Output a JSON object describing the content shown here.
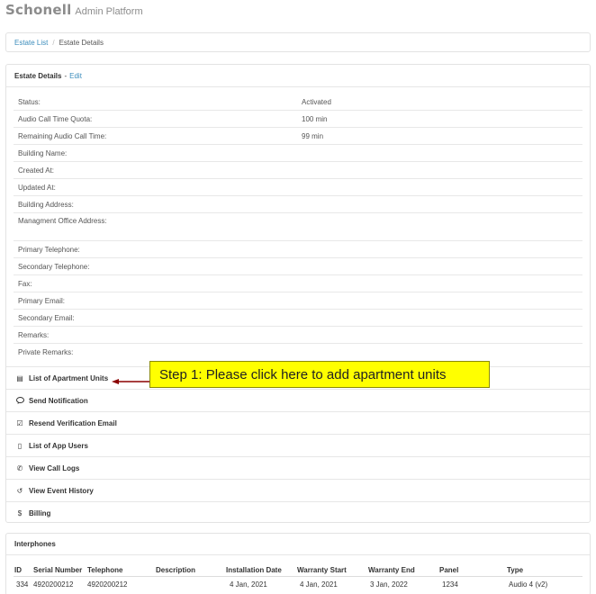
{
  "header": {
    "brand": "Schonell",
    "subtitle": "Admin Platform"
  },
  "breadcrumb": {
    "link": "Estate List",
    "separator": "/",
    "current": "Estate Details"
  },
  "estate": {
    "heading": "Estate Details",
    "dash": "-",
    "edit_label": "Edit",
    "fields": [
      {
        "label": "Status:",
        "value": "Activated"
      },
      {
        "label": "Audio Call Time Quota:",
        "value": "100 min"
      },
      {
        "label": "Remaining Audio Call Time:",
        "value": "99 min"
      },
      {
        "label": "Building Name:",
        "value": ""
      },
      {
        "label": "Created At:",
        "value": ""
      },
      {
        "label": "Updated At:",
        "value": ""
      },
      {
        "label": "Building Address:",
        "value": ""
      },
      {
        "label": "Managment Office Address:",
        "value": ""
      },
      {
        "label": "Primary Telephone:",
        "value": ""
      },
      {
        "label": "Secondary Telephone:",
        "value": ""
      },
      {
        "label": "Fax:",
        "value": ""
      },
      {
        "label": "Primary Email:",
        "value": ""
      },
      {
        "label": "Secondary Email:",
        "value": ""
      },
      {
        "label": "Remarks:",
        "value": ""
      },
      {
        "label": "Private Remarks:",
        "value": ""
      }
    ],
    "actions": [
      {
        "label": "List of Apartment Units",
        "icon": "list-card-icon",
        "glyph": "▤"
      },
      {
        "label": "Send Notification",
        "icon": "chat-icon",
        "glyph": "💬"
      },
      {
        "label": "Resend Verification Email",
        "icon": "check-square-icon",
        "glyph": "☑"
      },
      {
        "label": "List of App Users",
        "icon": "mobile-icon",
        "glyph": "▯"
      },
      {
        "label": "View Call Logs",
        "icon": "phone-icon",
        "glyph": "✆"
      },
      {
        "label": "View Event History",
        "icon": "history-icon",
        "glyph": "↺"
      },
      {
        "label": "Billing",
        "icon": "dollar-icon",
        "glyph": "$"
      }
    ]
  },
  "callout": {
    "text": "Step 1: Please click here to add apartment units",
    "color": "#ffff00",
    "arrow_color": "#8b0000"
  },
  "interphones": {
    "heading": "Interphones",
    "columns": [
      "ID",
      "Serial Number",
      "Telephone",
      "Description",
      "Installation Date",
      "Warranty Start",
      "Warranty End",
      "Panel",
      "Type"
    ],
    "rows": [
      [
        "334",
        "4920200212",
        "4920200212",
        "",
        "4 Jan, 2021",
        "4 Jan, 2021",
        "3 Jan, 2022",
        "1234",
        "Audio 4 (v2)"
      ]
    ]
  },
  "colors": {
    "link": "#3c8dbc",
    "border": "#e3e3e3"
  }
}
